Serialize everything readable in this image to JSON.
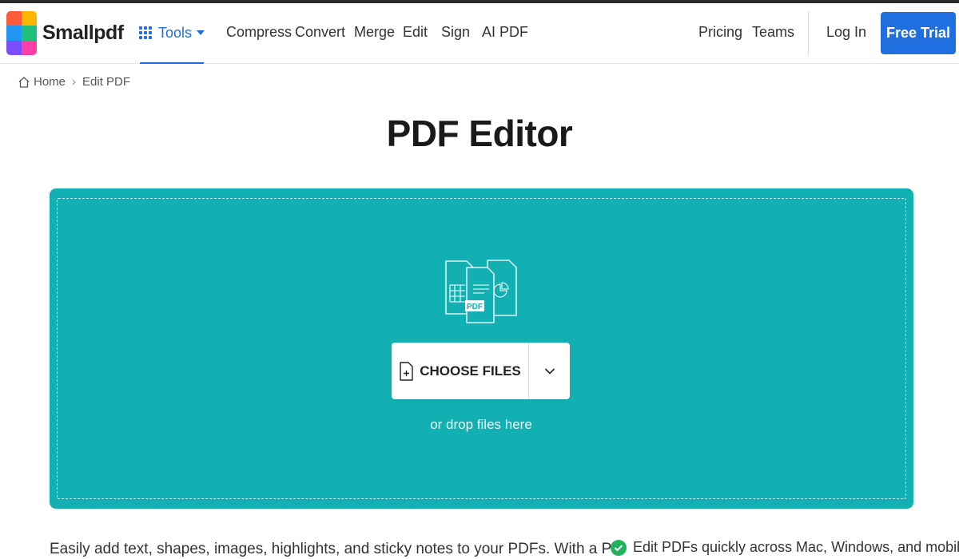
{
  "brand": {
    "name": "Smallpdf",
    "logo_colors": [
      "#ff5b3a",
      "#ffb400",
      "#21c07a",
      "#2196f3",
      "#7c4dff",
      "#ff3fa4"
    ]
  },
  "nav": {
    "tools_label": "Tools",
    "items": [
      "Compress",
      "Convert",
      "Merge",
      "Edit",
      "Sign",
      "AI PDF"
    ],
    "right_items": [
      "Pricing",
      "Teams"
    ],
    "login_label": "Log In",
    "cta_label": "Free Trial"
  },
  "breadcrumb": {
    "home_label": "Home",
    "separator": "›",
    "current_label": "Edit PDF"
  },
  "page": {
    "title": "PDF Editor"
  },
  "dropzone": {
    "illustration_badge": "PDF",
    "choose_label": "CHOOSE FILES",
    "hint": "or drop files here"
  },
  "content": {
    "description_fragment": "Easily add text, shapes, images, highlights, and sticky notes to your PDFs. With a Pro",
    "feature_1": "Edit PDFs quickly across Mac, Windows, and mobile"
  },
  "colors": {
    "accent": "#1f6fe0",
    "dropzone": "#12b0b3",
    "check": "#22b25d"
  },
  "icons": {
    "tools": "grid-dots-icon",
    "home": "home-icon",
    "file_add": "file-plus-icon",
    "caret": "chevron-down-icon",
    "check": "check-circle-icon"
  }
}
